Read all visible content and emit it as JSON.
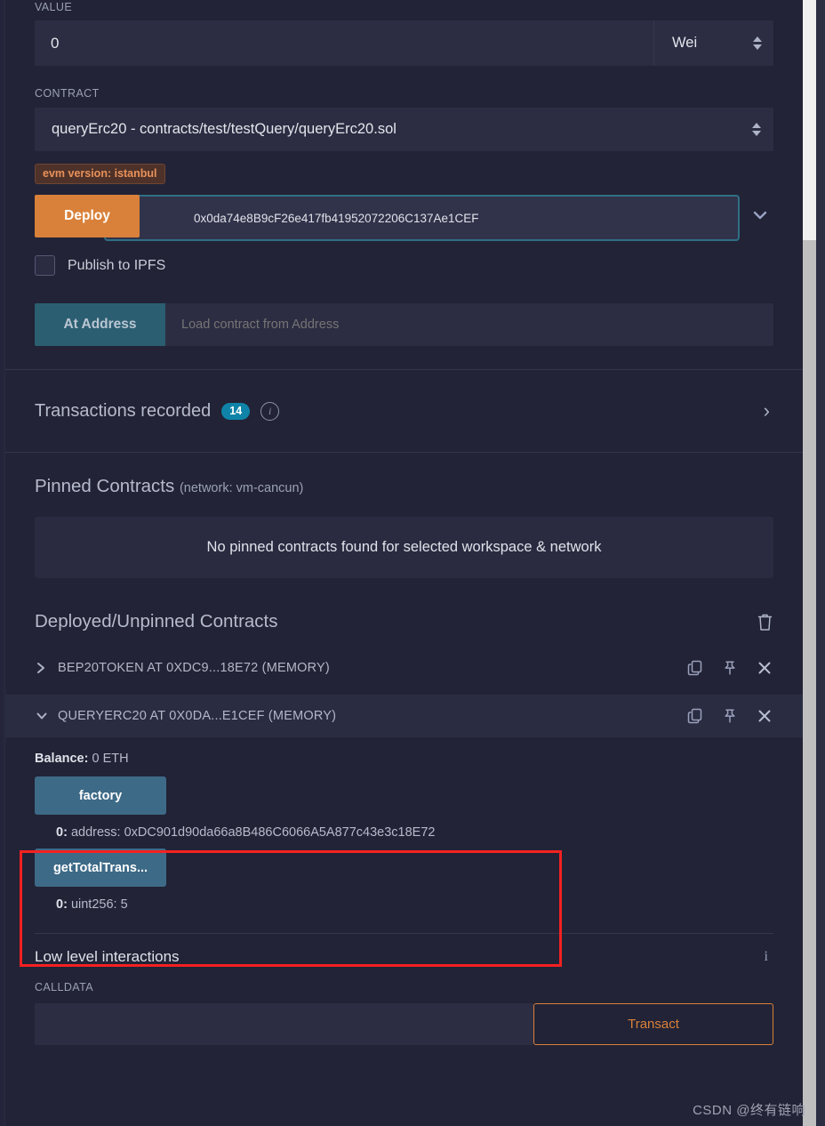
{
  "deploy_form": {
    "value_label": "VALUE",
    "value_amount": "0",
    "value_unit": "Wei",
    "contract_label": "CONTRACT",
    "contract_selected": "queryErc20 - contracts/test/testQuery/queryErc20.sol",
    "evm_version_badge": "evm version: istanbul",
    "deploy_button": "Deploy",
    "deploy_arg_value": "0x0da74e8B9cF26e417fb41952072206C137Ae1CEF",
    "publish_ipfs_label": "Publish to IPFS",
    "publish_ipfs_checked": false,
    "at_address_button": "At Address",
    "at_address_placeholder": "Load contract from Address"
  },
  "transactions": {
    "title": "Transactions recorded",
    "count": "14",
    "info_glyph": "i",
    "expand_glyph": "›"
  },
  "pinned": {
    "title": "Pinned Contracts",
    "network_note": "(network: vm-cancun)",
    "empty_message": "No pinned contracts found for selected workspace & network"
  },
  "deployed": {
    "title": "Deployed/Unpinned Contracts",
    "contracts": [
      {
        "caret": "›",
        "name": "BEP20TOKEN AT 0XDC9...18E72 (MEMORY)",
        "expanded": false
      },
      {
        "caret": "⌄",
        "name": "QUERYERC20 AT 0X0DA...E1CEF (MEMORY)",
        "expanded": true
      }
    ],
    "balance_label": "Balance:",
    "balance_value": "0 ETH",
    "functions": [
      {
        "button_label": "factory",
        "result_index": "0:",
        "result_value": "address: 0xDC901d90da66a8B486C6066A5A877c43e3c18E72"
      },
      {
        "button_label": "getTotalTrans...",
        "result_index": "0:",
        "result_value": "uint256: 5"
      }
    ]
  },
  "low_level": {
    "title": "Low level interactions",
    "info_glyph": "i",
    "calldata_label": "CALLDATA",
    "calldata_value": "",
    "transact_button": "Transact"
  },
  "watermark": "CSDN @终有链响",
  "colors": {
    "background": "#222336",
    "panel": "#2c2d42",
    "accent_orange": "#d9813a",
    "accent_teal": "#3d6a87",
    "badge_teal": "#0f84a8",
    "highlight_red": "#f52121"
  }
}
